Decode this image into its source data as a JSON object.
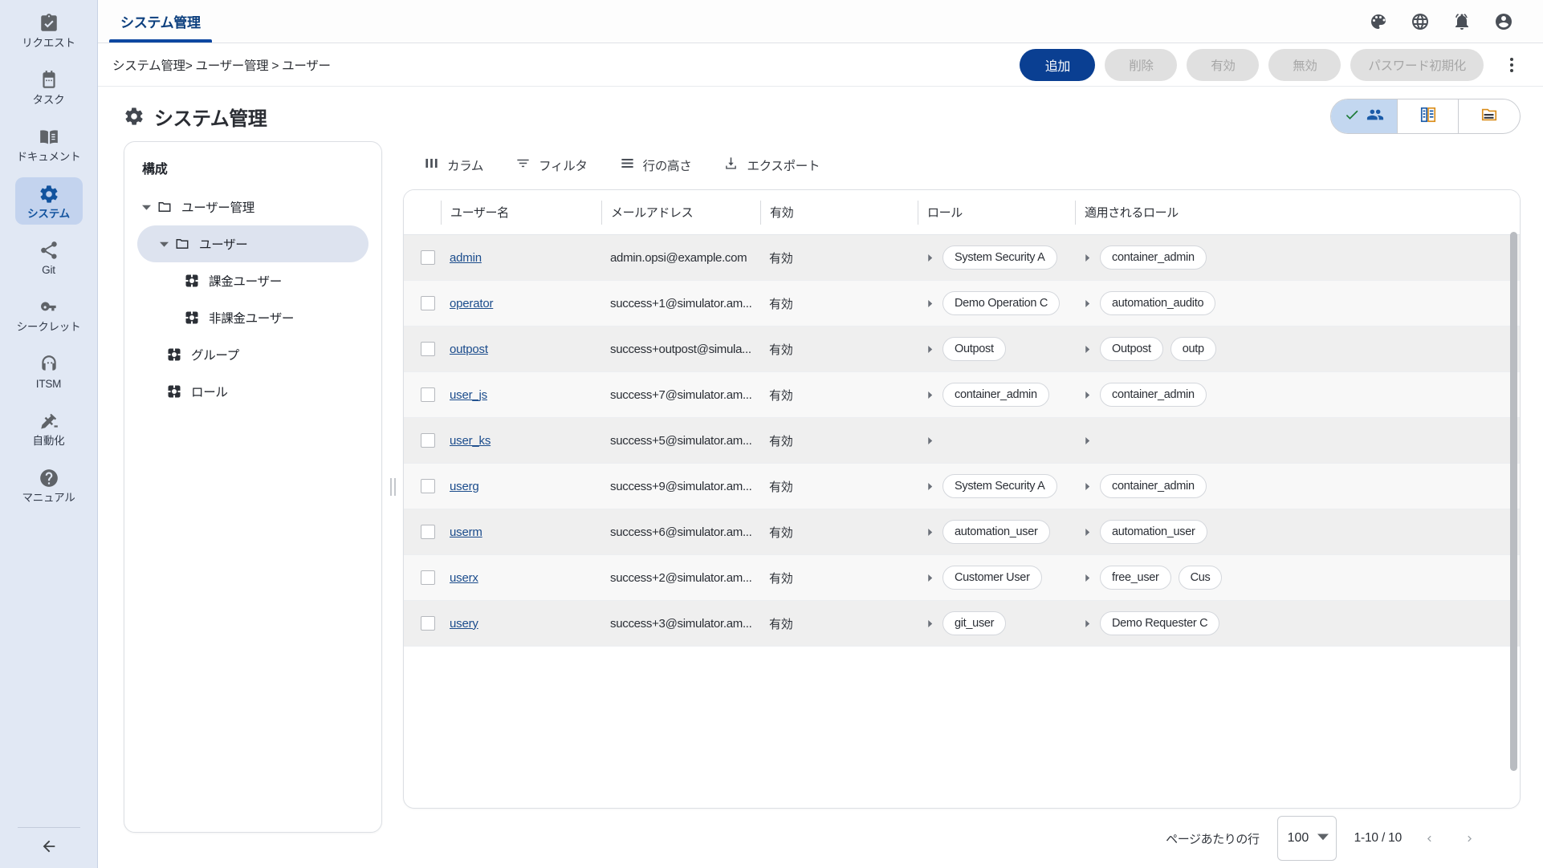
{
  "rail": {
    "items": [
      {
        "label": "リクエスト",
        "icon": "clipboard-check-icon",
        "active": false
      },
      {
        "label": "タスク",
        "icon": "calendar-icon",
        "active": false
      },
      {
        "label": "ドキュメント",
        "icon": "book-icon",
        "active": false
      },
      {
        "label": "システム",
        "icon": "gear-icon",
        "active": true
      },
      {
        "label": "Git",
        "icon": "share-icon",
        "active": false
      },
      {
        "label": "シークレット",
        "icon": "key-icon",
        "active": false
      },
      {
        "label": "ITSM",
        "icon": "headset-icon",
        "active": false
      },
      {
        "label": "自動化",
        "icon": "robot-arm-icon",
        "active": false
      },
      {
        "label": "マニュアル",
        "icon": "help-circle-icon",
        "active": false
      }
    ],
    "collapse_icon": "arrow-left-icon"
  },
  "topbar": {
    "tabs": [
      {
        "label": "システム管理",
        "active": true
      }
    ],
    "icons": [
      "palette-icon",
      "globe-icon",
      "bell-icon",
      "account-circle-icon"
    ]
  },
  "breadcrumb": {
    "text": "システム管理> ユーザー管理 > ユーザー"
  },
  "actions": {
    "add": "追加",
    "delete": "削除",
    "enable": "有効",
    "disable": "無効",
    "reset_password": "パスワード初期化",
    "overflow_icon": "more-vertical-icon"
  },
  "page": {
    "title": "システム管理",
    "title_icon": "gear-icon"
  },
  "view_toggle": {
    "segments": [
      {
        "name": "users-view",
        "icon": "people-icon",
        "checked": true,
        "check_icon": "check-icon"
      },
      {
        "name": "org-view",
        "icon": "building-list-icon",
        "checked": false
      },
      {
        "name": "folder-view",
        "icon": "folder-list-icon",
        "checked": false
      }
    ]
  },
  "tree": {
    "title": "構成",
    "nodes": [
      {
        "label": "ユーザー管理",
        "icon": "folder-icon",
        "indent": 0,
        "expanded": true,
        "selected": false
      },
      {
        "label": "ユーザー",
        "icon": "folder-icon",
        "indent": 1,
        "expanded": true,
        "selected": true
      },
      {
        "label": "課金ユーザー",
        "icon": "grid-square-icon",
        "indent": 2,
        "expanded": null,
        "selected": false
      },
      {
        "label": "非課金ユーザー",
        "icon": "grid-square-icon",
        "indent": 2,
        "expanded": null,
        "selected": false
      },
      {
        "label": "グループ",
        "icon": "grid-square-icon",
        "indent": 1.5,
        "expanded": null,
        "selected": false
      },
      {
        "label": "ロール",
        "icon": "grid-square-icon",
        "indent": 1.5,
        "expanded": null,
        "selected": false
      }
    ]
  },
  "table_toolbar": [
    {
      "label": "カラム",
      "icon": "columns-icon"
    },
    {
      "label": "フィルタ",
      "icon": "filter-icon"
    },
    {
      "label": "行の高さ",
      "icon": "density-icon"
    },
    {
      "label": "エクスポート",
      "icon": "download-icon"
    }
  ],
  "table": {
    "columns": [
      "ユーザー名",
      "メールアドレス",
      "有効",
      "ロール",
      "適用されるロール"
    ],
    "rows": [
      {
        "username": "admin",
        "email": "admin.opsi@example.com",
        "active": "有効",
        "roles": [
          "System Security A"
        ],
        "applied_roles": [
          "container_admin"
        ]
      },
      {
        "username": "operator",
        "email": "success+1@simulator.am...",
        "active": "有効",
        "roles": [
          "Demo Operation C"
        ],
        "applied_roles": [
          "automation_audito"
        ]
      },
      {
        "username": "outpost",
        "email": "success+outpost@simula...",
        "active": "有効",
        "roles": [
          "Outpost"
        ],
        "applied_roles": [
          "Outpost",
          "outp"
        ]
      },
      {
        "username": "user_js",
        "email": "success+7@simulator.am...",
        "active": "有効",
        "roles": [
          "container_admin"
        ],
        "applied_roles": [
          "container_admin"
        ]
      },
      {
        "username": "user_ks",
        "email": "success+5@simulator.am...",
        "active": "有効",
        "roles": [],
        "applied_roles": []
      },
      {
        "username": "userg",
        "email": "success+9@simulator.am...",
        "active": "有効",
        "roles": [
          "System Security A"
        ],
        "applied_roles": [
          "container_admin"
        ]
      },
      {
        "username": "userm",
        "email": "success+6@simulator.am...",
        "active": "有効",
        "roles": [
          "automation_user"
        ],
        "applied_roles": [
          "automation_user"
        ]
      },
      {
        "username": "userx",
        "email": "success+2@simulator.am...",
        "active": "有効",
        "roles": [
          "Customer User"
        ],
        "applied_roles": [
          "free_user",
          "Cus"
        ]
      },
      {
        "username": "usery",
        "email": "success+3@simulator.am...",
        "active": "有効",
        "roles": [
          "git_user"
        ],
        "applied_roles": [
          "Demo Requester C"
        ]
      }
    ]
  },
  "pagination": {
    "rows_per_page_label": "ページあたりの行",
    "rows_per_page_value": "100",
    "range": "1-10 / 10",
    "prev_icon": "chevron-left-icon",
    "next_icon": "chevron-right-icon"
  },
  "colors": {
    "rail_bg": "#e1e8f4",
    "rail_active_bg": "#c3d3ee",
    "accent": "#0d47a1",
    "primary_button": "#0a3f92",
    "link": "#1b4c8c",
    "check_green": "#1b7a35"
  }
}
